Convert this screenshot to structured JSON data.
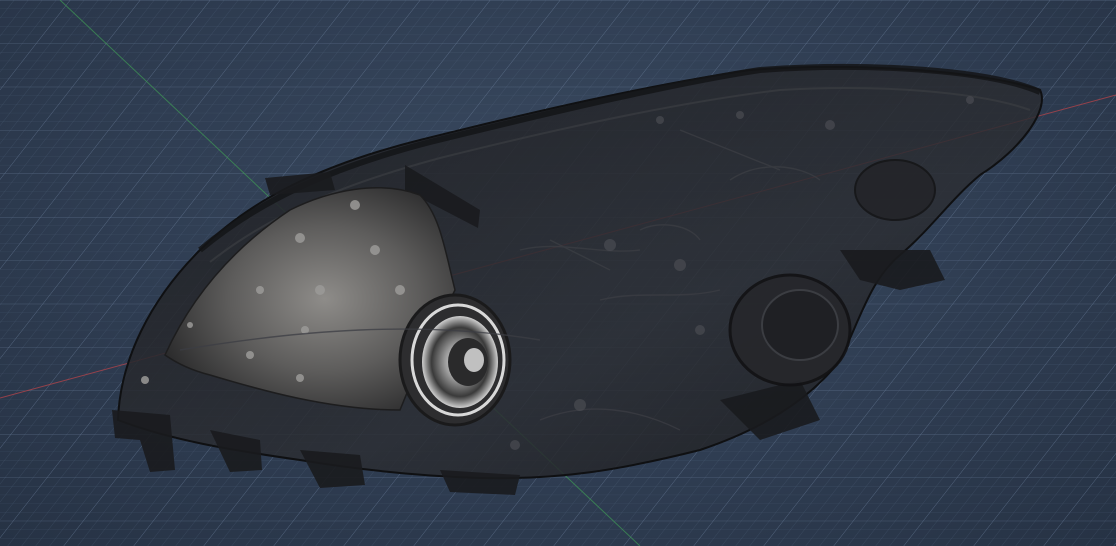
{
  "viewport": {
    "background_color": "#2f3d52",
    "grid_color": "#5a6f8c",
    "grid_major_color": "#6e84a2",
    "axis_x_color": "#b8444a",
    "axis_y_color": "#3f9a55"
  },
  "model": {
    "object": "headlamp-scan-mesh",
    "shell_color": "#2a2b2e",
    "reflector_color": "#6c6b6a",
    "bulb_ring_color": "#d9d9d9"
  }
}
